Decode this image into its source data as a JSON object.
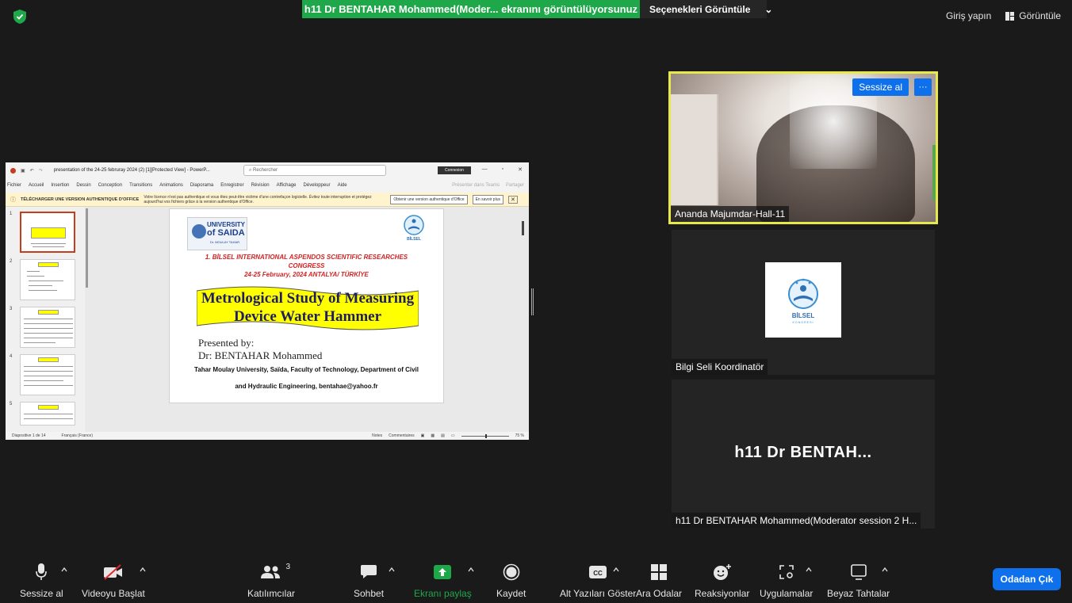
{
  "topbar": {
    "share_banner": "h11 Dr BENTAHAR Mohammed(Moder... ekranını görüntülüyorsunuz",
    "view_options": "Seçenekleri Görüntüle",
    "sign_in": "Giriş yapın",
    "view": "Görüntüle"
  },
  "powerpoint": {
    "title": "presentation of the 24-25 februray 2024 (2) [1][Protected View] - PowerP...",
    "search": "Rechercher",
    "connect": "Connexion",
    "menu": [
      "Fichier",
      "Accueil",
      "Insertion",
      "Dessin",
      "Conception",
      "Transitions",
      "Animations",
      "Diaporama",
      "Enregistrer",
      "Révision",
      "Affichage",
      "Développeur",
      "Aide"
    ],
    "menu_right": [
      "Présenter dans Teams",
      "Partager"
    ],
    "warning_title": "TÉLÉCHARGER UNE VERSION AUTHENTIQUE D'OFFICE",
    "warning_msg": "Votre licence n'est pas authentique et vous êtes peut-être victime d'une contrefaçon logicielle. Évitez toute interruption et protégez aujourd'hui vos fichiers grâce à la version authentique d'Office.",
    "warning_btn1": "Obtenir une version authentique d'Office",
    "warning_btn2": "En savoir plus",
    "thumb_numbers": [
      "1",
      "2",
      "3",
      "4",
      "5"
    ],
    "slide": {
      "uni_line1": "UNIVERSITY",
      "uni_line2": "of SAIDA",
      "uni_line3": "Dr. MOULAY TAHAR",
      "bilsel_logo": "BİLSEL",
      "congress_line1": "1. BİLSEL INTERNATIONAL ASPENDOS SCIENTIFIC RESEARCHES",
      "congress_line2": "CONGRESS",
      "congress_line3": "24-25 February, 2024 ANTALYA/ TÜRKİYE",
      "title_line1": "Metrological Study of Measuring",
      "title_line2": "Device  Water Hammer",
      "presented_by": "Presented by:",
      "presenter": "Dr: BENTAHAR Mohammed",
      "affiliation_line1": "Tahar Moulay University, Saïda, Faculty of Technology, Department of Civil",
      "affiliation_line2": "and Hydraulic Engineering, bentahae@yahoo.fr"
    },
    "status_slide": "Diapositive 1 de 14",
    "status_lang": "Français (France)",
    "status_notes": "Notes",
    "status_comments": "Commentaires",
    "status_zoom": "75 %"
  },
  "participants": {
    "tile_a_name": "Ananda Majumdar-Hall-11",
    "tile_a_mute": "Sessize al",
    "tile_a_more": "···",
    "tile_b_name": "Bilgi Seli Koordinatör",
    "tile_b_logo": "BİLSEL",
    "tile_b_logo_sub": "KONGRESİ",
    "tile_c_big": "h11 Dr BENTAH...",
    "tile_c_name": "h11 Dr BENTAHAR Mohammed(Moderator session 2 H..."
  },
  "toolbar": {
    "mute": "Sessize al",
    "video": "Videoyu Başlat",
    "participants": "Katılımcılar",
    "participants_count": "3",
    "chat": "Sohbet",
    "share": "Ekranı paylaş",
    "record": "Kaydet",
    "cc_icon_text": "CC",
    "captions": "Alt Yazıları Göster",
    "breakout": "Ara Odalar",
    "reactions": "Reaksiyonlar",
    "apps": "Uygulamalar",
    "whiteboard": "Beyaz Tahtalar",
    "leave": "Odadan Çık"
  },
  "colors": {
    "banner_green": "#1fa84a",
    "accent_blue": "#0e71eb",
    "speaker_border": "#e8e84a"
  }
}
